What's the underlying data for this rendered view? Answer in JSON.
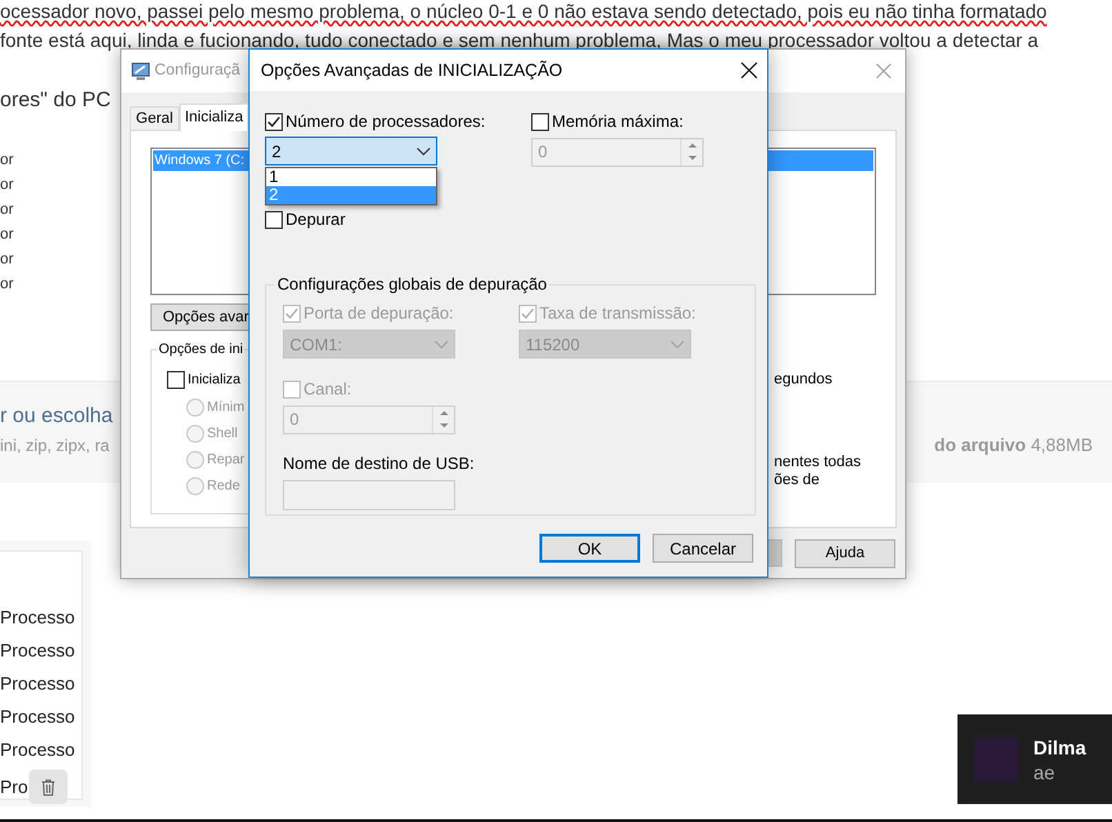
{
  "article": {
    "lines": [
      "ocessador novo, passei pelo mesmo problema, o núcleo 0-1 e 0 não estava sendo detectado, pois eu não tinha formatado",
      "fonte está aqui, linda e fucionando, tudo conectado e sem nenhum problema, Mas o meu processador voltou a detectar a"
    ],
    "heading_fragment": "ores\" do PC",
    "list_fragments": [
      "or",
      "or",
      "or",
      "or",
      "or",
      "or"
    ]
  },
  "upload": {
    "prompt": "r ou escolha",
    "formats": "ini, zip, zipx, ra",
    "max_size": "**do arquivo** 4,88MB"
  },
  "attachments": {
    "items": [
      "Processo",
      "Processo",
      "Processo",
      "Processo",
      "Processo",
      "Pro"
    ]
  },
  "system_config_window": {
    "title": "Configuraçã",
    "tabs": [
      {
        "label": "Geral",
        "selected": false
      },
      {
        "label": "Inicializa",
        "selected": true
      }
    ],
    "boot_entries": [
      {
        "label": "Windows 7 (C:",
        "selected": true
      }
    ],
    "advanced_button": "Opções avar",
    "boot_options": {
      "legend": "Opções de ini",
      "safe_boot": {
        "label": "Inicializa",
        "checked": false
      },
      "radios": [
        {
          "label": "Mínim",
          "selected": false,
          "disabled": true
        },
        {
          "label": "Shell",
          "selected": false,
          "disabled": true
        },
        {
          "label": "Repar",
          "selected": false,
          "disabled": true
        },
        {
          "label": "Rede",
          "selected": false,
          "disabled": true
        }
      ]
    },
    "right_texts": [
      "egundos",
      "nentes todas",
      "ões de"
    ],
    "help_button": "Ajuda"
  },
  "advanced_dialog": {
    "title": "Opções Avançadas de INICIALIZAÇÃO",
    "processors": {
      "label": "Número de processadores:",
      "checked": true,
      "value": "2",
      "expanded": true,
      "options": [
        {
          "label": "1",
          "selected": false
        },
        {
          "label": "2",
          "selected": true
        }
      ]
    },
    "max_memory": {
      "label": "Memória máxima:",
      "checked": false,
      "value": "0"
    },
    "debug": {
      "label": "Depurar",
      "checked": false
    },
    "debug_settings": {
      "legend": "Configurações globais de depuração",
      "port": {
        "label": "Porta de depuração:",
        "checked": true,
        "disabled": true,
        "value": "COM1:"
      },
      "baud": {
        "label": "Taxa de transmissão:",
        "checked": true,
        "disabled": true,
        "value": "115200"
      },
      "channel": {
        "label": "Canal:",
        "checked": false,
        "disabled": true,
        "value": "0"
      },
      "usb": {
        "label": "Nome de destino de USB:"
      }
    },
    "buttons": [
      {
        "label": "OK",
        "default": true
      },
      {
        "label": "Cancelar",
        "default": false
      }
    ]
  },
  "notification": {
    "name": "Dilma",
    "message": "ae"
  }
}
